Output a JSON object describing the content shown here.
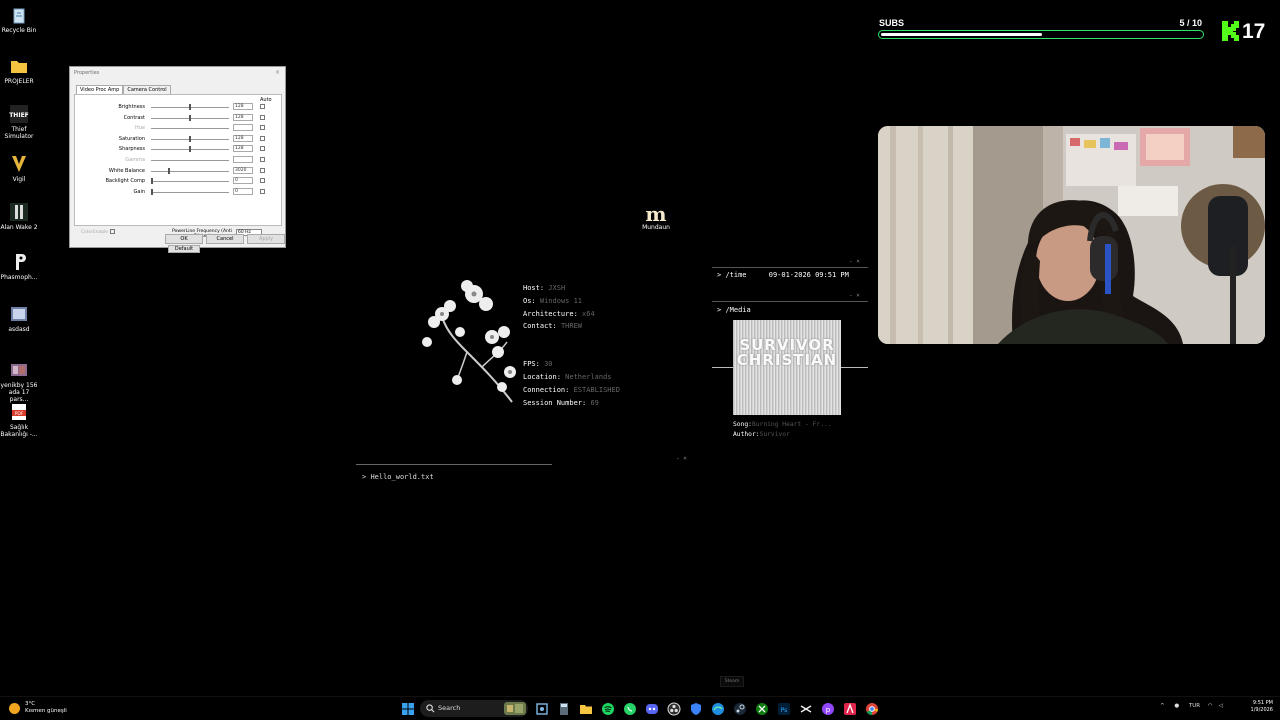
{
  "desktop": {
    "icons": [
      {
        "label": "Recycle Bin",
        "icon": "recycle-bin-icon"
      },
      {
        "label": "PROJELER",
        "icon": "folder-icon"
      },
      {
        "label": "Thief Simulator",
        "icon": "thief-simulator-icon"
      },
      {
        "label": "Vigil",
        "icon": "vigil-icon"
      },
      {
        "label": "Alan Wake 2",
        "icon": "alan-wake-icon"
      },
      {
        "label": "Phasmoph...",
        "icon": "phasmophobia-icon"
      },
      {
        "label": "asdasd",
        "icon": "video-file-icon"
      },
      {
        "label": "yenikby 156 ada 17 pars...",
        "icon": "image-file-icon"
      },
      {
        "label": "Sağlık Bakanlığı -...",
        "icon": "pdf-icon"
      }
    ],
    "mundaun": {
      "label": "Mundaun",
      "glyph": "m"
    }
  },
  "dialog": {
    "title": "Properties",
    "close": "×",
    "tabs": [
      "Video Proc Amp",
      "Camera Control"
    ],
    "auto_header": "Auto",
    "rows": [
      {
        "label": "Brightness",
        "value": "128",
        "level": 0.5,
        "enabled": true
      },
      {
        "label": "Contrast",
        "value": "128",
        "level": 0.5,
        "enabled": true
      },
      {
        "label": "Hue",
        "value": "",
        "level": 0.0,
        "enabled": false
      },
      {
        "label": "Saturation",
        "value": "128",
        "level": 0.5,
        "enabled": true
      },
      {
        "label": "Sharpness",
        "value": "128",
        "level": 0.5,
        "enabled": true
      },
      {
        "label": "Gamma",
        "value": "",
        "level": 0.0,
        "enabled": false
      },
      {
        "label": "White Balance",
        "value": "3020",
        "level": 0.23,
        "enabled": true
      },
      {
        "label": "Backlight Comp",
        "value": "0",
        "level": 0.0,
        "enabled": true
      },
      {
        "label": "Gain",
        "value": "0",
        "level": 0.0,
        "enabled": true
      }
    ],
    "color_enable": "ColorEnable",
    "powerline_label": "PowerLine Frequency (Anti Flicker)",
    "powerline_value": "60 Hz",
    "default_btn": "Default",
    "ok": "OK",
    "cancel": "Cancel",
    "apply": "Apply"
  },
  "sysinfo": [
    {
      "key": "Host:",
      "value": "JXSH"
    },
    {
      "key": "Os:",
      "value": "Windows 11"
    },
    {
      "key": "Architecture:",
      "value": "x64"
    },
    {
      "key": "Contact:",
      "value": "THREW"
    }
  ],
  "sysinfo2": [
    {
      "key": "FPS:",
      "value": "30"
    },
    {
      "key": "Location:",
      "value": "Netherlands"
    },
    {
      "key": "Connection:",
      "value": "ESTABLISHED"
    },
    {
      "key": "Session Number:",
      "value": "69"
    }
  ],
  "time_panel": {
    "prompt": ">",
    "label": "/time",
    "value": "09-01-2026 09:51 PM",
    "controls": "- ×"
  },
  "media_panel": {
    "prompt": ">",
    "label": "/Media",
    "cover_text": "SURVIVOR CHRISTIAN",
    "song_key": "Song:",
    "song_value": "Burning Heart - Fr...",
    "author_key": "Author:",
    "author_value": "Survivor"
  },
  "hello": {
    "prompt": ">",
    "text": "Hello_world.txt",
    "controls": "- ×"
  },
  "subs": {
    "label": "SUBS",
    "count": "5 / 10",
    "progress": 0.5
  },
  "kick": {
    "count": "17",
    "color": "#53fc18"
  },
  "steam_tooltip": "Steam",
  "taskbar": {
    "weather_temp": "3°C",
    "weather_desc": "Kısmen güneşli",
    "search_placeholder": "Search",
    "apps": [
      "windows-start-icon",
      "search-icon",
      "widgets-icon",
      "snipping-icon",
      "file-explorer-icon",
      "spotify-icon",
      "whatsapp-icon",
      "discord-icon",
      "obs-icon",
      "steam-icon",
      "xbox-icon",
      "photoshop-icon",
      "kick-icon",
      "adobe-icon",
      "chrome-icon"
    ],
    "tray_lang": "TUR",
    "time": "9:51 PM",
    "date": "1/9/2026"
  }
}
